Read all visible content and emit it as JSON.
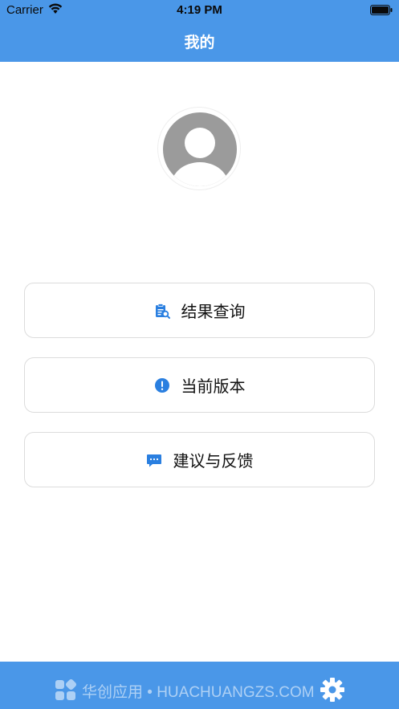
{
  "status_bar": {
    "carrier": "Carrier",
    "time": "4:19 PM"
  },
  "nav": {
    "title": "我的"
  },
  "menu": [
    {
      "label": "结果查询",
      "icon": "clipboard-search-icon"
    },
    {
      "label": "当前版本",
      "icon": "info-exclamation-icon"
    },
    {
      "label": "建议与反馈",
      "icon": "chat-bubble-icon"
    }
  ],
  "watermark": {
    "text": "华创应用 • HUACHUANGZS.COM"
  },
  "colors": {
    "primary": "#4a97e8",
    "icon": "#2a7fe0"
  }
}
